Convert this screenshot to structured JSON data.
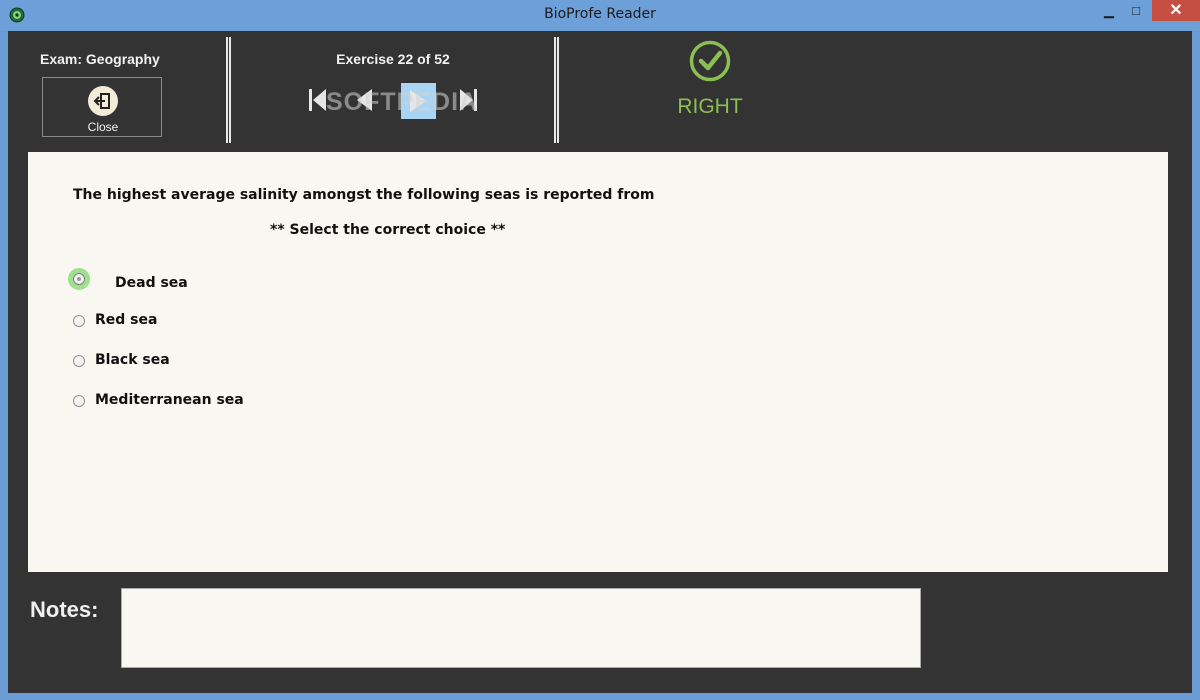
{
  "window": {
    "title": "BioProfe Reader",
    "minimize_glyph": "▁",
    "maximize_glyph": "□",
    "close_glyph": "✕"
  },
  "header": {
    "exam_label": "Exam:  Geography",
    "close_label": "Close",
    "exercise_label": "Exercise 22 of 52",
    "watermark": "SOFTPEDIA",
    "result_label": "RIGHT"
  },
  "question": {
    "text": "The highest average salinity amongst the following seas is reported from",
    "instruction": "** Select the correct choice **",
    "options": [
      {
        "label": "Dead sea",
        "selected": true
      },
      {
        "label": "Red sea",
        "selected": false
      },
      {
        "label": "Black sea",
        "selected": false
      },
      {
        "label": "Mediterranean sea",
        "selected": false
      }
    ]
  },
  "notes": {
    "label": "Notes:",
    "value": ""
  },
  "colors": {
    "background": "#333333",
    "panel": "#f8f7f2",
    "result_green": "#8bbf52",
    "selected_halo": "#9fe08e",
    "nav_highlight": "#a9d4f3",
    "titlebar": "#6d9fd8",
    "close_red": "#c74e43"
  },
  "icons": {
    "app": "bioprofe-app-icon",
    "close": "exit-door-icon",
    "first": "skip-first-icon",
    "prev": "previous-icon",
    "next": "next-icon",
    "last": "skip-last-icon",
    "result": "check-circle-icon"
  }
}
